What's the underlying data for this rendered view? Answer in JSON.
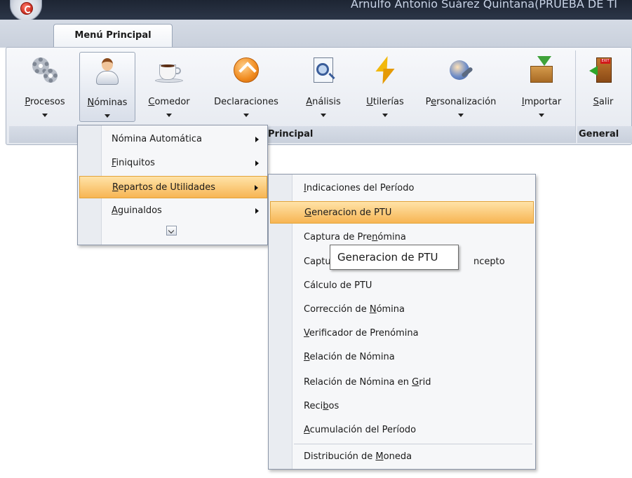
{
  "window": {
    "title": "Arnulfo Antonio Suárez Quintana(PRUEBA DE TI"
  },
  "ribbon": {
    "tab_label": "Menú Principal",
    "group_main_label": "Menú Principal",
    "group_main_visible_label": "Principal",
    "group_general_label": "General",
    "buttons": [
      {
        "label": "Procesos",
        "icon": "gears-icon",
        "underline": "P",
        "rest": "rocesos"
      },
      {
        "label": "Nóminas",
        "icon": "employee-icon",
        "underline": "N",
        "rest": "óminas"
      },
      {
        "label": "Comedor",
        "icon": "coffee-cup-icon",
        "underline": "C",
        "rest": "omedor"
      },
      {
        "label": "Declaraciones",
        "icon": "declaration-arrow-icon"
      },
      {
        "label": "Análisis",
        "icon": "document-magnifier-icon",
        "underline": "A",
        "rest": "nálisis"
      },
      {
        "label": "Utilerías",
        "icon": "lightning-icon",
        "underline": "U",
        "rest": "tilerías"
      },
      {
        "label": "Personalización",
        "icon": "user-settings-icon",
        "pre": "P",
        "underline": "e",
        "rest": "rsonalización"
      },
      {
        "label": "Importar",
        "icon": "import-box-icon",
        "underline": "I",
        "rest": "mportar"
      },
      {
        "label": "Salir",
        "icon": "exit-door-icon",
        "underline": "S",
        "rest": "alir"
      }
    ]
  },
  "nominas_menu": {
    "items": [
      {
        "label": "Nómina Automática",
        "pre": "",
        "underline": "",
        "rest": "Nómina Automática",
        "has_submenu": true
      },
      {
        "label": "Finiquitos",
        "pre": "",
        "underline": "F",
        "rest": "iniquitos",
        "has_submenu": true
      },
      {
        "label": "Repartos de Utilidades",
        "pre": "",
        "underline": "R",
        "rest": "epartos de Utilidades",
        "has_submenu": true,
        "highlighted": true
      },
      {
        "label": "Aguinaldos",
        "pre": "",
        "underline": "A",
        "rest": "guinaldos",
        "has_submenu": true
      }
    ]
  },
  "ptu_submenu": {
    "items": [
      {
        "pre": "",
        "underline": "I",
        "rest": "ndicaciones del Período"
      },
      {
        "pre": "",
        "underline": "G",
        "rest": "eneracion de PTU",
        "highlighted": true
      },
      {
        "pre": "Captura de Pre",
        "underline": "n",
        "rest": "ómina"
      },
      {
        "pre": "Captu",
        "underline": "",
        "rest": "",
        "tail": "ncepto"
      },
      {
        "pre": "Cálculo de PTU",
        "underline": "",
        "rest": ""
      },
      {
        "pre": "Corrección de ",
        "underline": "N",
        "rest": "ómina"
      },
      {
        "pre": "",
        "underline": "V",
        "rest": "erificador de Prenómina"
      },
      {
        "pre": "",
        "underline": "R",
        "rest": "elación de Nómina"
      },
      {
        "pre": "Relación de Nómina en ",
        "underline": "G",
        "rest": "rid"
      },
      {
        "pre": "Reci",
        "underline": "b",
        "rest": "os"
      },
      {
        "pre": "",
        "underline": "A",
        "rest": "cumulación del Período"
      },
      {
        "pre": "Distribución de ",
        "underline": "M",
        "rest": "oneda"
      }
    ]
  },
  "tooltip": {
    "text": "Generacion de PTU"
  }
}
